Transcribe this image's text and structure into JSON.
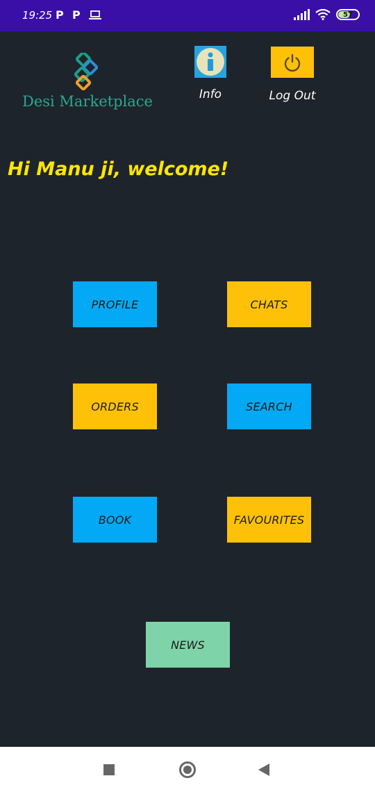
{
  "status_bar": {
    "time": "19:25",
    "app_icons": [
      "P",
      "P"
    ],
    "battery_level": "57"
  },
  "header": {
    "logo_text": "Desi Marketplace",
    "info_label": "Info",
    "logout_label": "Log Out"
  },
  "welcome_text": "Hi Manu ji, welcome!",
  "menu": {
    "profile": "PROFILE",
    "chats": "CHATS",
    "orders": "ORDERS",
    "search": "SEARCH",
    "book": "BOOK",
    "favourites": "FAVOURITES",
    "news": "NEWS"
  },
  "colors": {
    "status_bar": "#3a0fa8",
    "background": "#1e242c",
    "accent_blue": "#03a9f4",
    "accent_yellow": "#ffc107",
    "accent_green": "#7fd3a8",
    "welcome_text": "#ffe600"
  },
  "icons": {
    "info": "info-icon",
    "logout": "power-icon",
    "wifi": "wifi-icon",
    "signal": "signal-icon",
    "battery": "battery-icon",
    "screen": "laptop-icon"
  }
}
